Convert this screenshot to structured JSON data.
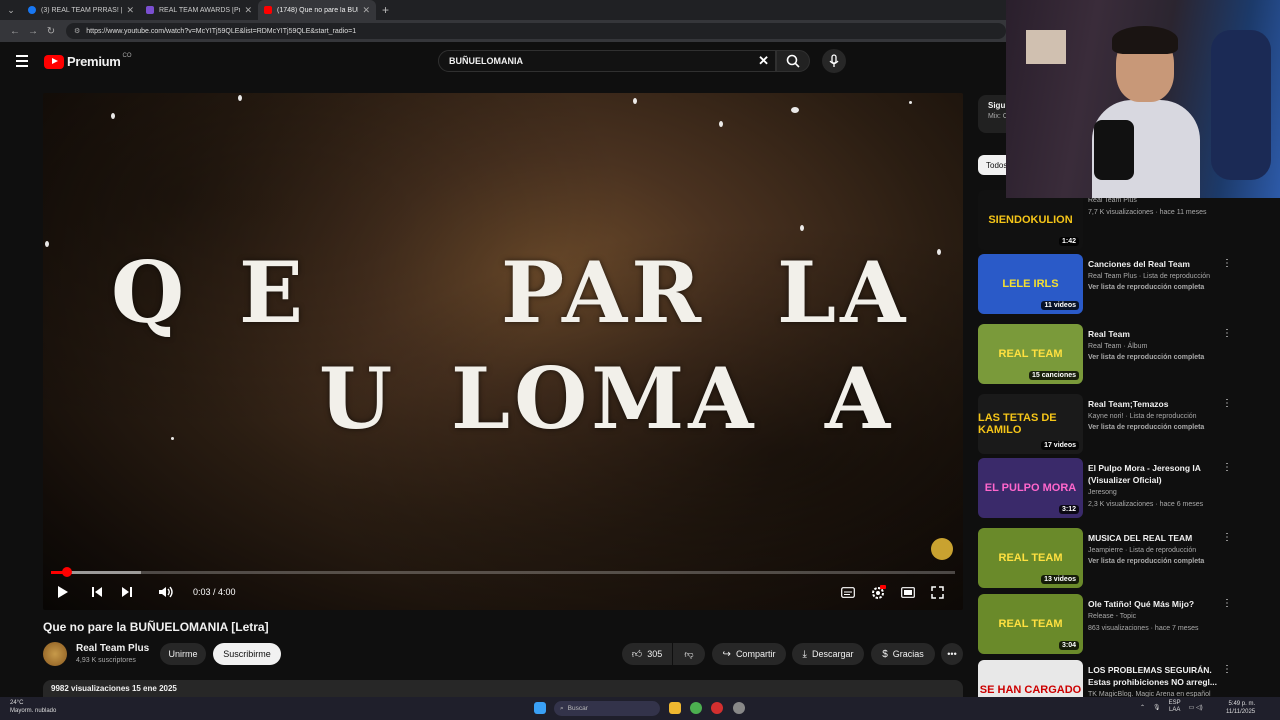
{
  "browser": {
    "tabs": [
      {
        "label": "(3) REAL TEAM PRRAS! | Facebook",
        "color": "#1877f2"
      },
      {
        "label": "REAL TEAM AWARDS [Pre-nominaciones]",
        "color": "#7b4fd0"
      },
      {
        "label": "(1748) Que no pare la BUÑUELOMANIA",
        "color": "#ff0000"
      }
    ],
    "url": "https://www.youtube.com/watch?v=McYITj59QLE&list=RDMcYITj59QLE&start_radio=1"
  },
  "header": {
    "logo_text": "Premium",
    "logo_sup": "CO",
    "search_value": "BUÑUELOMANIA"
  },
  "player": {
    "lyric_line1": [
      "Q",
      "E",
      "PAR",
      "LA"
    ],
    "lyric_line2": [
      "U",
      "LOMA",
      "A"
    ],
    "time": "0:03 / 4:00",
    "progress": 0.0125
  },
  "video": {
    "title": "Que no pare la BUÑUELOMANIA [Letra]",
    "channel": "Real Team Plus",
    "subscribers": "4,93 K suscriptores",
    "join_label": "Unirme",
    "subscribe_label": "Suscribirme",
    "likes": "305",
    "share_label": "Compartir",
    "download_label": "Descargar",
    "thanks_label": "Gracias",
    "views_date": "9982 visualizaciones  15 ene 2025"
  },
  "sidebar": {
    "next_label": "Sigu",
    "next_sub": "Mix: C",
    "chip_label": "Todos",
    "items": [
      {
        "thumb_text": "SIENDOKULION",
        "thumb_bg": "#111",
        "thumb_fg": "#f5c518",
        "badge": "1:42",
        "title": "",
        "meta1": "Real Team Plus",
        "meta2": "7,7 K visualizaciones · hace 11 meses",
        "link": ""
      },
      {
        "thumb_text": "LELE IRLS",
        "thumb_bg": "#2a5ac8",
        "thumb_fg": "#f5e030",
        "badge": "11 videos",
        "title": "Canciones del Real Team",
        "meta1": "Real Team Plus · Lista de reproducción",
        "meta2": "",
        "link": "Ver lista de reproducción completa"
      },
      {
        "thumb_text": "REAL TEAM",
        "thumb_bg": "#7a9a3a",
        "thumb_fg": "#ffe040",
        "badge": "15 canciones",
        "title": "Real Team",
        "meta1": "Real Team · Álbum",
        "meta2": "",
        "link": "Ver lista de reproducción completa"
      },
      {
        "thumb_text": "LAS TETAS DE KAMILO",
        "thumb_bg": "#1a1a1a",
        "thumb_fg": "#f5c518",
        "badge": "17 videos",
        "title": "Real Team;Temazos",
        "meta1": "Kayne nori! · Lista de reproducción",
        "meta2": "",
        "link": "Ver lista de reproducción completa"
      },
      {
        "thumb_text": "EL PULPO MORA",
        "thumb_bg": "#3a2a6a",
        "thumb_fg": "#ff66cc",
        "badge": "3:12",
        "title": "El Pulpo Mora - Jeresong IA (Visualizer Oficial)",
        "meta1": "Jeresong",
        "meta2": "2,3 K visualizaciones · hace 6 meses",
        "link": ""
      },
      {
        "thumb_text": "REAL TEAM",
        "thumb_bg": "#6a8a2a",
        "thumb_fg": "#ffe040",
        "badge": "13 videos",
        "title": "MUSICA DEL REAL TEAM",
        "meta1": "Jeampierre · Lista de reproducción",
        "meta2": "",
        "link": "Ver lista de reproducción completa"
      },
      {
        "thumb_text": "REAL TEAM",
        "thumb_bg": "#6a8a2a",
        "thumb_fg": "#ffe040",
        "badge": "3:04",
        "title": "Ole Tatiño! Qué Más Mijo?",
        "meta1": "Release - Topic",
        "meta2": "863 visualizaciones · hace 7 meses",
        "link": ""
      },
      {
        "thumb_text": "SE HAN CARGADO",
        "thumb_bg": "#e8e8e8",
        "thumb_fg": "#c00",
        "badge": "",
        "title": "LOS PROBLEMAS SEGUIRÁN. Estas prohibiciones NO arregl...",
        "meta1": "TK MagicBlog. Magic Arena en español",
        "meta2": "",
        "link": ""
      }
    ]
  },
  "taskbar": {
    "weather_temp": "24°C",
    "weather_desc": "Mayorm. nublado",
    "search_placeholder": "Buscar",
    "lang1": "ESP",
    "lang2": "LAA",
    "time": "5:49 p. m.",
    "date": "11/11/2025"
  }
}
